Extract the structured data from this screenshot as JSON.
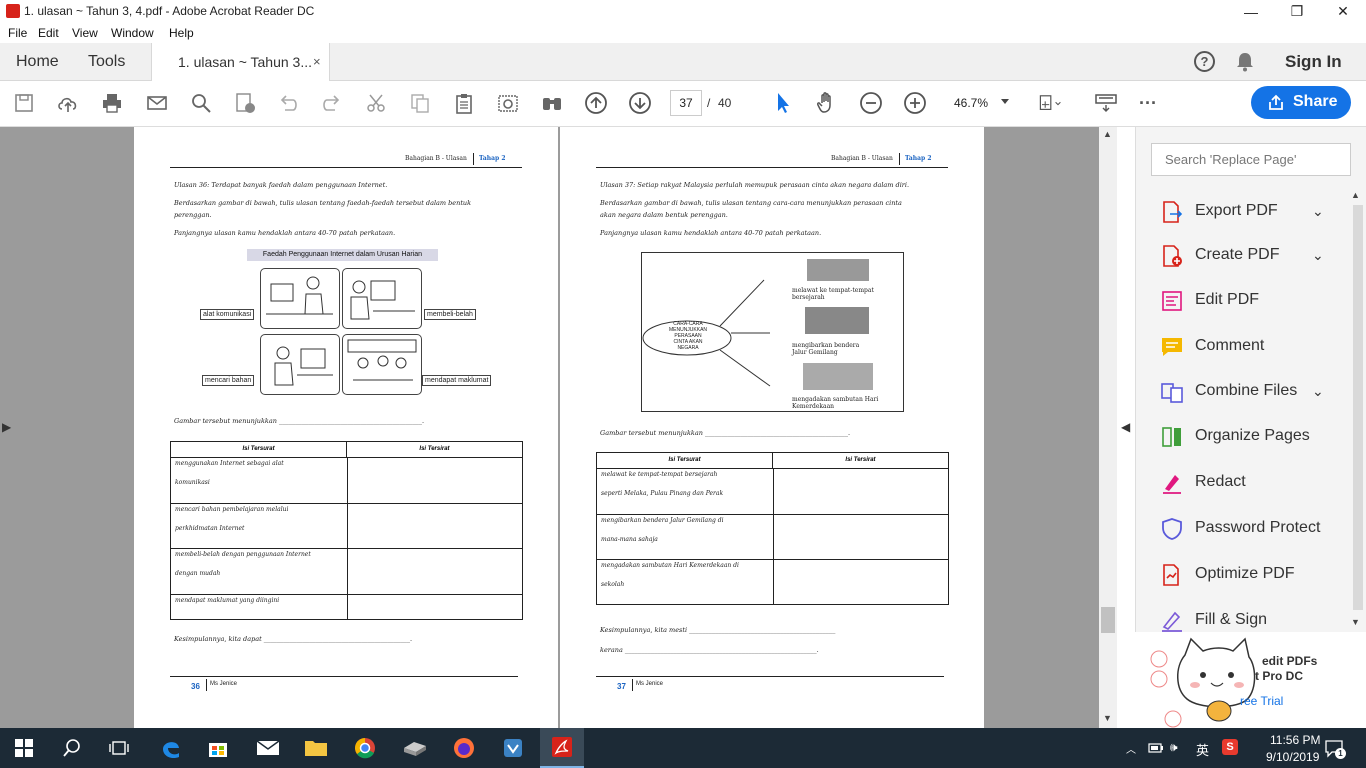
{
  "window": {
    "title": "1. ulasan ~ Tahun 3, 4.pdf - Adobe Acrobat Reader DC",
    "minimize": "—",
    "maximize": "❐",
    "close": "✕"
  },
  "menu": [
    "File",
    "Edit",
    "View",
    "Window",
    "Help"
  ],
  "tabs": {
    "home": "Home",
    "tools": "Tools",
    "document": "1. ulasan ~ Tahun 3...",
    "close": "×"
  },
  "header_right": {
    "help": "?",
    "sign_in": "Sign In"
  },
  "toolbar": {
    "page_current": "37",
    "page_sep": "/",
    "page_total": "40",
    "zoom": "46.7%",
    "share": "Share",
    "more": "···"
  },
  "right_panel": {
    "search_placeholder": "Search 'Replace Page'",
    "tools": [
      {
        "label": "Export PDF",
        "icon": "export-pdf-icon",
        "color": "#d7231a",
        "expandable": true
      },
      {
        "label": "Create PDF",
        "icon": "create-pdf-icon",
        "color": "#d7231a",
        "expandable": true
      },
      {
        "label": "Edit PDF",
        "icon": "edit-pdf-icon",
        "color": "#e0177f",
        "expandable": false
      },
      {
        "label": "Comment",
        "icon": "comment-icon",
        "color": "#f5b800",
        "expandable": false
      },
      {
        "label": "Combine Files",
        "icon": "combine-files-icon",
        "color": "#5a5adb",
        "expandable": true
      },
      {
        "label": "Organize Pages",
        "icon": "organize-pages-icon",
        "color": "#3f9e3a",
        "expandable": false
      },
      {
        "label": "Redact",
        "icon": "redact-icon",
        "color": "#e0177f",
        "expandable": false
      },
      {
        "label": "Password Protect",
        "icon": "shield-icon",
        "color": "#5a5adb",
        "expandable": false
      },
      {
        "label": "Optimize PDF",
        "icon": "optimize-pdf-icon",
        "color": "#d7231a",
        "expandable": false
      },
      {
        "label": "Fill & Sign",
        "icon": "fill-sign-icon",
        "color": "#7b5ad8",
        "expandable": false
      }
    ],
    "promo_line1": "edit PDFs",
    "promo_line2": "t Pro DC",
    "promo_link": "ree Trial"
  },
  "page36": {
    "header_left": "Bahagian B - Ulasan",
    "header_right": "Tahap 2",
    "q": "Ulasan 36: Terdapat banyak faedah dalam penggunaan Internet.",
    "instr1": "Berdasarkan gambar di bawah, tulis ulasan tentang faedah-faedah tersebut dalam bentuk",
    "instr1b": "perenggan.",
    "instr2": "Panjangnya ulasan kamu hendaklah antara 40-70 patah perkataan.",
    "figure_title": "Faedah Penggunaan Internet dalam Urusan Harian",
    "labels": [
      "alat komunikasi",
      "membeli-belah",
      "mencari bahan",
      "mendapat maklumat"
    ],
    "gambar": "Gambar tersebut menunjukkan ____________________________________________.",
    "col1": "Isi Tersurat",
    "col2": "Isi Tersirat",
    "rows": [
      [
        "menggunakan Internet sebagai alat",
        "komunikasi"
      ],
      [
        "mencari bahan pembelajaran melalui",
        "perkhidmatan Internet"
      ],
      [
        "membeli-belah dengan penggunaan Internet",
        "dengan mudah"
      ],
      [
        "mendapat maklumat yang diingini",
        ""
      ]
    ],
    "kesimpulan": "Kesimpulannya, kita dapat _____________________________________________.",
    "page_no": "36",
    "author": "Ms Jenice"
  },
  "page37": {
    "header_left": "Bahagian B - Ulasan",
    "header_right": "Tahap 2",
    "q": "Ulasan 37: Setiap rakyat Malaysia perlulah memupuk perasaan cinta akan negara dalam diri.",
    "instr1": "Berdasarkan gambar di bawah, tulis ulasan tentang cara-cara menunjukkan perasaan cinta",
    "instr1b": "akan negara dalam bentuk perenggan.",
    "instr2": "Panjangnya ulasan kamu hendaklah antara 40-70 patah perkataan.",
    "center_lines": [
      "CARA-CARA",
      "MENUNJUKKAN",
      "PERASAAN",
      "CINTA AKAN",
      "NEGARA"
    ],
    "branch1": [
      "melawat ke tempat-tempat",
      "bersejarah"
    ],
    "branch2": [
      "mengibarkan bendera",
      "Jalur Gemilang"
    ],
    "branch3": [
      "mengadakan sambutan Hari",
      "Kemerdekaan"
    ],
    "gambar": "Gambar tersebut menunjukkan ____________________________________________.",
    "col1": "Isi Tersurat",
    "col2": "Isi Tersirat",
    "rows": [
      [
        "melawat ke tempat-tempat bersejarah",
        "seperti Melaka, Pulau Pinang dan Perak"
      ],
      [
        "mengibarkan bendera Jalur Gemilang di",
        "mana-mana sahaja"
      ],
      [
        "mengadakan sambutan Hari Kemerdekaan di",
        "sekolah"
      ]
    ],
    "kesimpulan": "Kesimpulannya, kita mesti _____________________________________________",
    "kerana": "kerana ___________________________________________________________.",
    "page_no": "37",
    "author": "Ms Jenice"
  },
  "taskbar": {
    "time": "11:56 PM",
    "date": "9/10/2019",
    "lang": "英",
    "notif": "1"
  }
}
